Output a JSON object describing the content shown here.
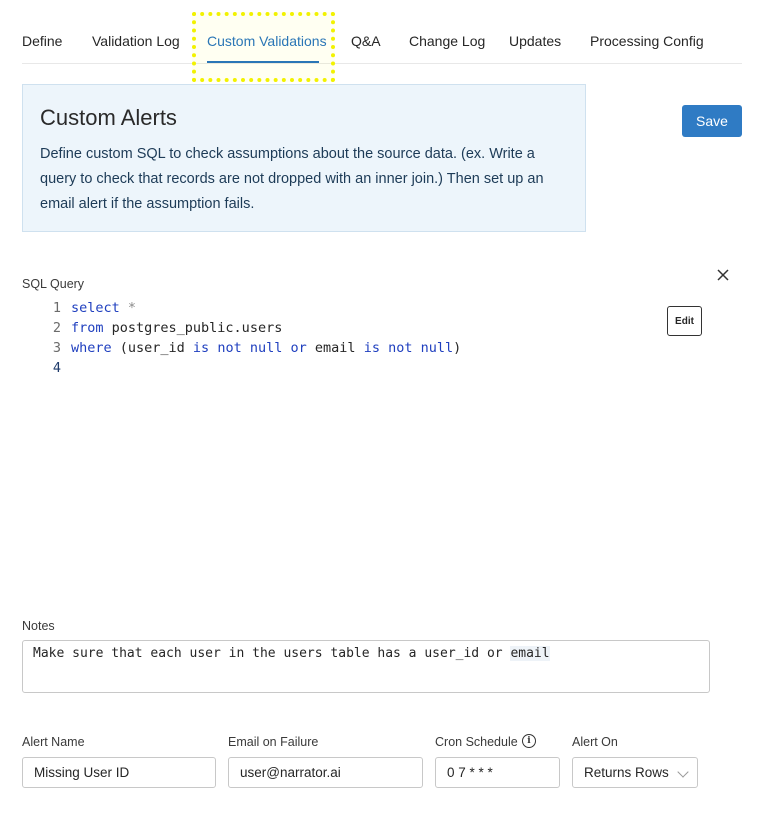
{
  "tabs": [
    {
      "label": "Define"
    },
    {
      "label": "Validation Log"
    },
    {
      "label": "Custom Validations",
      "active": true
    },
    {
      "label": "Q&A"
    },
    {
      "label": "Change Log"
    },
    {
      "label": "Updates"
    },
    {
      "label": "Processing Config"
    }
  ],
  "info_panel": {
    "title": "Custom Alerts",
    "description": "Define custom SQL to check assumptions about the source data. (ex. Write a query to check that records are not dropped with an inner join.) Then set up an email alert if the assumption fails."
  },
  "save_label": "Save",
  "sql": {
    "label": "SQL Query",
    "edit_label": "Edit",
    "lines": [
      {
        "number": "1",
        "text": "select *"
      },
      {
        "number": "2",
        "text": "from postgres_public.users"
      },
      {
        "number": "3",
        "text": "where (user_id is not null or email is not null)"
      },
      {
        "number": "4",
        "text": ""
      }
    ]
  },
  "notes": {
    "label": "Notes",
    "value_prefix": "Make sure that each user in the users table has a user_id or ",
    "value_highlight": "email"
  },
  "alert_name": {
    "label": "Alert Name",
    "value": "Missing User ID"
  },
  "email_on_failure": {
    "label": "Email on Failure",
    "value": "user@narrator.ai"
  },
  "cron_schedule": {
    "label": "Cron Schedule",
    "value": "0 7 * * *"
  },
  "alert_on": {
    "label": "Alert On",
    "value": "Returns Rows"
  },
  "colors": {
    "accent": "#1f6fc0",
    "save_button": "#2f7bc4",
    "info_bg": "#edf5fb",
    "highlight": "#f2f200",
    "sql_keyword": "#1f3fbf"
  },
  "icons": {
    "close": "close-icon",
    "info": "info-icon",
    "select_arrow": "chevron-down-icon"
  }
}
